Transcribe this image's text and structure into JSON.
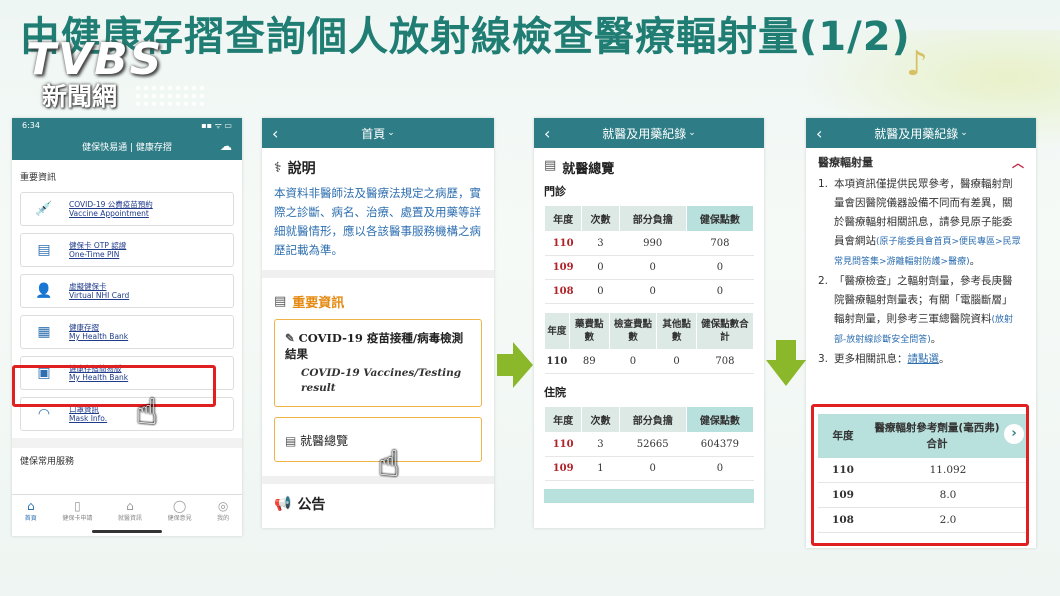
{
  "headline": "由健康存摺查詢個人放射線檢查醫療輻射量(1/2)",
  "watermark": {
    "brand": "TVBS",
    "sub": "新聞網"
  },
  "colors": {
    "teal": "#2e7d86",
    "headline": "#1f7d73",
    "highlight_red": "#e02020",
    "orange": "#e58a12",
    "arrow_green": "#8ab82a"
  },
  "phone1": {
    "time": "6:34",
    "signal": "▪▪ ᯤ ▭",
    "title": "健保快易通 | 健康存摺",
    "section_important": "重要資訊",
    "cards": [
      {
        "icon": "syringe-icon",
        "glyph": "💉",
        "label_zh": "COVID-19 公費疫苗預約",
        "label_en": "Vaccine Appointment"
      },
      {
        "icon": "pin-card-icon",
        "glyph": "▤",
        "label_zh": "健保卡 OTP 認證",
        "label_en": "One-Time PIN"
      },
      {
        "icon": "virtual-card-icon",
        "glyph": "👤",
        "label_zh": "虛擬健保卡",
        "label_en": "Virtual NHI Card"
      },
      {
        "icon": "health-bank-icon",
        "glyph": "▦",
        "label_zh": "健康存摺",
        "label_en": "My Health Bank"
      },
      {
        "icon": "health-bank-simple-icon",
        "glyph": "▣",
        "label_zh": "健康存摺簡易版",
        "label_en": "My Health Bank"
      },
      {
        "icon": "mask-icon",
        "glyph": "◠",
        "label_zh": "口罩資訊",
        "label_en": "Mask Info."
      }
    ],
    "section_common": "健保常用服務",
    "tabs": [
      {
        "icon": "home-icon",
        "glyph": "⌂",
        "label": "首頁"
      },
      {
        "icon": "card-icon",
        "glyph": "▯",
        "label": "健保卡申請"
      },
      {
        "icon": "hospital-icon",
        "glyph": "⌂",
        "label": "就醫資訊"
      },
      {
        "icon": "chat-icon",
        "glyph": "◯",
        "label": "健保意見"
      },
      {
        "icon": "more-icon",
        "glyph": "◎",
        "label": "我的"
      }
    ]
  },
  "phone2": {
    "nav_title": "首頁",
    "desc_title": "說明",
    "desc_text": "本資料非醫師法及醫療法規定之病歷，實際之診斷、病名、治療、處置及用藥等詳細就醫情形，應以各該醫事服務機構之病歷記載為準。",
    "important_title": "重要資訊",
    "covid_zh": "COVID-19 疫苗接種/病毒檢測結果",
    "covid_en": "COVID-19 Vaccines/Testing result",
    "summary_label": "就醫總覽",
    "announce_label": "公告"
  },
  "phone3": {
    "nav_title": "就醫及用藥紀錄",
    "heading": "就醫總覽",
    "outpatient": "門診",
    "table1": {
      "headers": [
        "年度",
        "次數",
        "部分負擔",
        "健保點數"
      ],
      "rows": [
        [
          "110",
          "3",
          "990",
          "708"
        ],
        [
          "109",
          "0",
          "0",
          "0"
        ],
        [
          "108",
          "0",
          "0",
          "0"
        ]
      ]
    },
    "table2": {
      "headers": [
        "年度",
        "藥費點數",
        "檢查費點數",
        "其他點數",
        "健保點數合計"
      ],
      "rows": [
        [
          "110",
          "89",
          "0",
          "0",
          "708"
        ]
      ]
    },
    "inpatient": "住院",
    "table3": {
      "headers": [
        "年度",
        "次數",
        "部分負擔",
        "健保點數"
      ],
      "rows": [
        [
          "110",
          "3",
          "52665",
          "604379"
        ],
        [
          "109",
          "1",
          "0",
          "0"
        ]
      ]
    }
  },
  "phone4": {
    "nav_title": "就醫及用藥紀錄",
    "section": "醫療輻射量",
    "item1": "本項資訊僅提供民眾參考，醫療輻射劑量會因醫院儀器設備不同而有差異，關於醫療輻射相關訊息，請參見原子能委員會網站",
    "item1_link": "(原子能委員會首頁>便民專區>民眾常見問答集>游離輻射防護>醫療)",
    "item1_end": "。",
    "item2": "「醫療檢查」之輻射劑量，參考長庚醫院醫療輻射劑量表；有關「電腦斷層」輻射劑量，則參考三軍總醫院資料",
    "item2_link": "(放射部-放射線診斷安全問答)",
    "item2_end": "。",
    "item3": "更多相關訊息：",
    "item3_link": "請點選",
    "item3_end": "。",
    "table": {
      "col1": "年度",
      "col2": "醫療輻射參考劑量(毫西弗) 合計",
      "rows": [
        [
          "110",
          "11.092"
        ],
        [
          "109",
          "8.0"
        ],
        [
          "108",
          "2.0"
        ]
      ]
    }
  }
}
